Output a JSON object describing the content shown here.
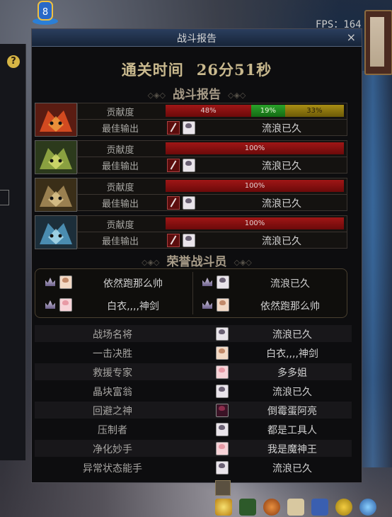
{
  "hud": {
    "fps": "FPS：164"
  },
  "window": {
    "title": "战斗报告",
    "close": "×"
  },
  "clear_time": {
    "label": "通关时间",
    "value": "26分51秒"
  },
  "battle_report": {
    "title": "战斗报告",
    "contribution_label": "贡献度",
    "best_output_label": "最佳输出",
    "players": [
      {
        "portrait": "red-warrior-portrait",
        "segments": [
          {
            "pct": 48,
            "label": "48%",
            "color": "red"
          },
          {
            "pct": 19,
            "label": "19%",
            "color": "green"
          },
          {
            "pct": 33,
            "label": "33%",
            "color": "gold"
          }
        ],
        "best_name": "流浪已久"
      },
      {
        "portrait": "green-warrior-portrait",
        "segments": [
          {
            "pct": 100,
            "label": "100%",
            "color": "red"
          }
        ],
        "best_name": "流浪已久"
      },
      {
        "portrait": "gold-warrior-portrait",
        "segments": [
          {
            "pct": 100,
            "label": "100%",
            "color": "red"
          }
        ],
        "best_name": "流浪已久"
      },
      {
        "portrait": "blue-warrior-portrait",
        "segments": [
          {
            "pct": 100,
            "label": "100%",
            "color": "red"
          }
        ],
        "best_name": "流浪已久"
      }
    ]
  },
  "honor": {
    "title": "荣誉战斗员",
    "members": [
      "依然跑那么帅",
      "流浪已久",
      "白衣,,,,神剑",
      "依然跑那么帅"
    ]
  },
  "awards": [
    {
      "title": "战场名将",
      "name": "流浪已久"
    },
    {
      "title": "一击决胜",
      "name": "白衣,,,,神剑"
    },
    {
      "title": "救援专家",
      "name": "多多姐"
    },
    {
      "title": "晶块富翁",
      "name": "流浪已久"
    },
    {
      "title": "回避之神",
      "name": "倒霉蛋阿亮"
    },
    {
      "title": "压制者",
      "name": "都是工具人"
    },
    {
      "title": "净化妙手",
      "name": "我是魔神王"
    },
    {
      "title": "异常状态能手",
      "name": "流浪已久"
    }
  ],
  "colors": {
    "red": "#a01616",
    "green": "#2aa22a",
    "gold": "#a98e14",
    "accent": "#c9b98e"
  }
}
